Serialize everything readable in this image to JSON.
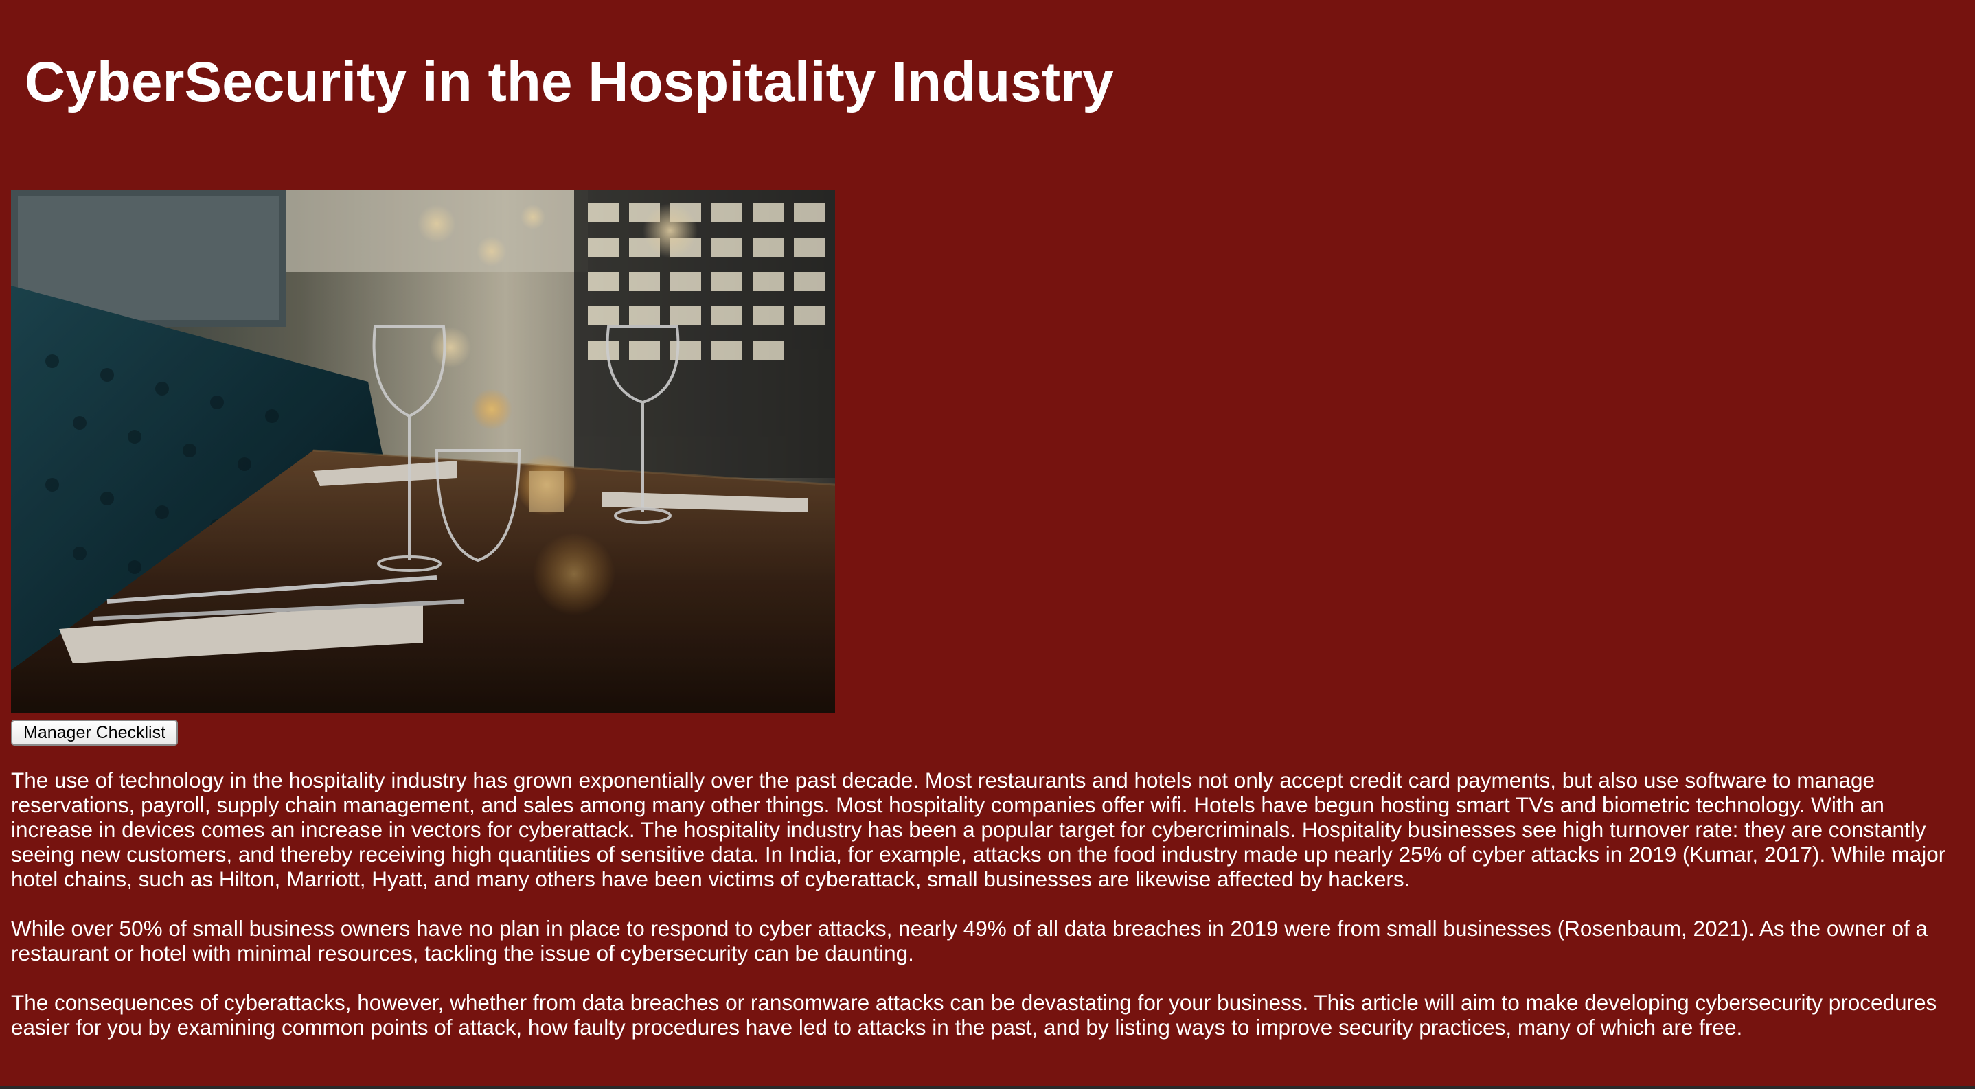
{
  "page": {
    "title": "CyberSecurity in the Hospitality Industry",
    "background_color": "#76130f",
    "text_color": "#ffffff"
  },
  "hero_image": {
    "icon": "restaurant-table-photo"
  },
  "checklist_button": {
    "label": "Manager Checklist"
  },
  "article": {
    "paragraphs": [
      "The use of technology in the hospitality industry has grown exponentially over the past decade. Most restaurants and hotels not only accept credit card payments, but also use software to manage reservations, payroll, supply chain management, and sales among many other things. Most hospitality companies offer wifi. Hotels have begun hosting smart TVs and biometric technology. With an increase in devices comes an increase in vectors for cyberattack. The hospitality industry has been a popular target for cybercriminals. Hospitality businesses see high turnover rate: they are constantly seeing new customers, and thereby receiving high quantities of sensitive data. In India, for example, attacks on the food industry made up nearly 25% of cyber attacks in 2019 (Kumar, 2017). While major hotel chains, such as Hilton, Marriott, Hyatt, and many others have been victims of cyberattack, small businesses are likewise affected by hackers.",
      "While over 50% of small business owners have no plan in place to respond to cyber attacks, nearly 49% of all data breaches in 2019 were from small businesses (Rosenbaum, 2021). As the owner of a restaurant or hotel with minimal resources, tackling the issue of cybersecurity can be daunting.",
      "The consequences of cyberattacks, however, whether from data breaches or ransomware attacks can be devastating for your business. This article will aim to make developing cybersecurity procedures easier for you by examining common points of attack, how faulty procedures have led to attacks in the past, and by listing ways to improve security practices, many of which are free."
    ]
  }
}
